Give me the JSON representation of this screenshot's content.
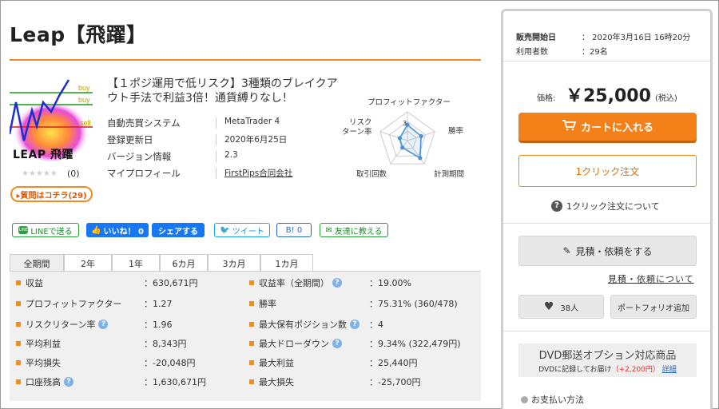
{
  "product": {
    "title": "Leap【飛躍】",
    "headline": "【１ポジ運用で低リスク】3種類のブレイクアウト手法で利益3倍！通貨縛りなし！",
    "logo_text": "LEAP 飛躍",
    "thumb_labels": {
      "buy1": "buy",
      "buy2": "buy",
      "sell": "sell"
    },
    "stars": "★★★★★",
    "review_count": "(0)",
    "qa_button": "▸質問はコチラ(29)"
  },
  "info": [
    {
      "key": "自動売買システム",
      "value": "MetaTrader 4"
    },
    {
      "key": "登録更新日",
      "value": "2020年6月25日"
    },
    {
      "key": "バージョン情報",
      "value": "2.3"
    },
    {
      "key": "マイプロフィール",
      "value": "FirstPips合同会社"
    }
  ],
  "radar": {
    "labels": {
      "top": "プロフィットファクター",
      "right_top": "勝率",
      "right_bottom": "計測期間",
      "left_bottom": "取引回数",
      "left_top": "リスク\nターン率"
    },
    "scale_label": "3",
    "values": [
      0.55,
      0.5,
      0.75,
      0.3,
      0.28
    ]
  },
  "social": {
    "line": "LINEで送る",
    "like": "いいね！ 0",
    "share": "シェアする",
    "tweet": "ツイート",
    "hatena": "B! 0",
    "friend": "友達に教える"
  },
  "tabs": [
    "全期間",
    "2年",
    "1年",
    "6カ月",
    "3カ月",
    "1カ月"
  ],
  "stats_left": [
    {
      "label": "収益",
      "value": "：630,671円",
      "help": false
    },
    {
      "label": "プロフィットファクター",
      "value": "：1.27",
      "help": false
    },
    {
      "label": "リスクリターン率",
      "value": "：1.96",
      "help": true
    },
    {
      "label": "平均利益",
      "value": "：8,343円",
      "help": false
    },
    {
      "label": "平均損失",
      "value": "：-20,048円",
      "help": false
    },
    {
      "label": "口座残高",
      "value": "：1,630,671円",
      "help": true
    }
  ],
  "stats_right": [
    {
      "label": "収益率（全期間）",
      "value": "：19.00%",
      "help": true
    },
    {
      "label": "勝率",
      "value": "：75.31% (360/478)",
      "help": false
    },
    {
      "label": "最大保有ポジション数",
      "value": "：4",
      "help": true
    },
    {
      "label": "最大ドローダウン",
      "value": "：9.34% (322,479円)",
      "help": true
    },
    {
      "label": "最大利益",
      "value": "：25,440円",
      "help": false
    },
    {
      "label": "最大損失",
      "value": "：-25,700円",
      "help": false
    }
  ],
  "panel": {
    "sale_start_label": "販売開始日",
    "sale_start_value": "：  2020年3月16日 16時20分",
    "users_label": "利用者数",
    "users_value": "：29名",
    "price_label": "価格:",
    "price": "￥25,000",
    "tax": "(税込)",
    "cart_button": "カートに入れる",
    "oneclick_button": "1クリック注文",
    "oneclick_about": "1クリック注文について",
    "quote_button": "見積・依頼をする",
    "quote_link": "見積・依頼について",
    "fav_count": "38人",
    "portfolio_button": "ポートフォリオ追加",
    "dvd_title": "DVD郵送オプション対応商品",
    "dvd_sub_prefix": "DVDに記録してお届け",
    "dvd_price": "（+2,200円）",
    "dvd_detail": "詳細",
    "payment": "お支払い方法"
  },
  "colors": {
    "accent": "#f08c21",
    "cart": "#f4801a",
    "facebook": "#1877f2",
    "line_green": "#2aa13b",
    "radar_line": "#4a90d9"
  }
}
